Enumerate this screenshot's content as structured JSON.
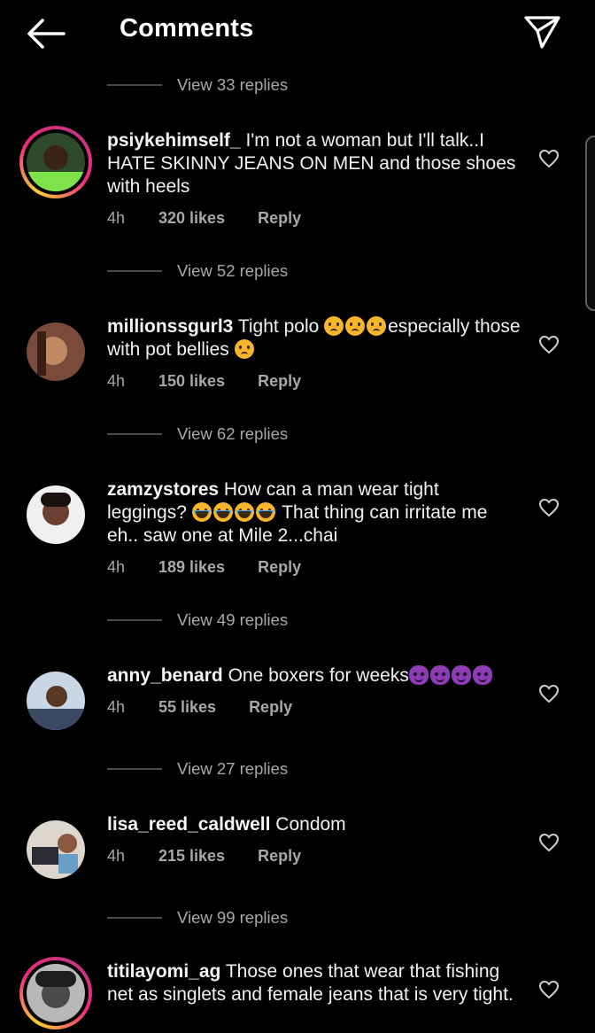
{
  "header": {
    "title": "Comments",
    "back_icon": "arrow-left-icon",
    "send_icon": "paper-plane-icon"
  },
  "view_replies_top": "View 33 replies",
  "comments": [
    {
      "username": "psiykehimself_",
      "text": "I'm not a woman but I'll talk..I HATE SKINNY JEANS ON MEN and those shoes with heels",
      "time": "4h",
      "likes": "320 likes",
      "reply": "Reply",
      "view_replies": "View 52 replies",
      "story_ring": true
    },
    {
      "username": "millionssgurl3",
      "text_parts": [
        "Tight polo ",
        "especially those with pot bellies "
      ],
      "emoji_1": "crying-face-emoji",
      "emoji_2": "crying-face-emoji",
      "time": "4h",
      "likes": "150 likes",
      "reply": "Reply",
      "view_replies": "View 62 replies",
      "story_ring": false
    },
    {
      "username": "zamzystores",
      "text_parts": [
        "How can a man wear tight leggings? ",
        " That thing can irritate me eh.. saw one at Mile 2...chai"
      ],
      "emoji_1": "loudly-crying-face-emoji",
      "time": "4h",
      "likes": "189 likes",
      "reply": "Reply",
      "view_replies": "View 49 replies",
      "story_ring": false
    },
    {
      "username": "anny_benard",
      "text_parts": [
        "One boxers for weeks"
      ],
      "emoji_1": "smiling-imp-emoji",
      "time": "4h",
      "likes": "55 likes",
      "reply": "Reply",
      "view_replies": "View 27 replies",
      "story_ring": false
    },
    {
      "username": "lisa_reed_caldwell",
      "text": "Condom",
      "time": "4h",
      "likes": "215 likes",
      "reply": "Reply",
      "view_replies": "View 99 replies",
      "story_ring": false
    },
    {
      "username": "titilayomi_ag",
      "text": "Those ones that wear that fishing net as singlets and female jeans that is very tight.",
      "story_ring": true
    }
  ],
  "colors": {
    "background": "#000000",
    "text": "#f5f5f5",
    "muted": "#a8a8a8",
    "divider": "#4a4a4a"
  }
}
